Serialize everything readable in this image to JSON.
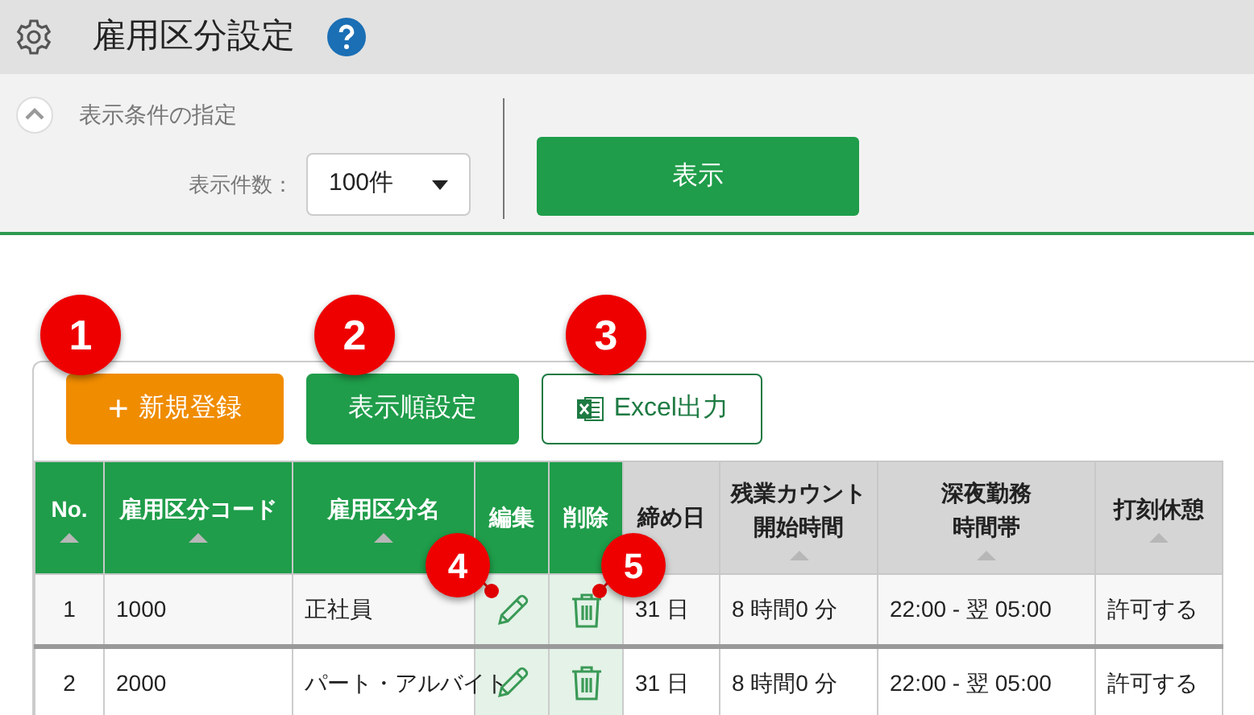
{
  "page_title": "雇用区分設定",
  "conditions": {
    "title": "表示条件の指定",
    "expanded": true,
    "count_label": "表示件数：",
    "count_value": "100件",
    "show_button": "表示"
  },
  "toolbar": [
    {
      "kind": "new",
      "icon": "+",
      "label": "新規登録"
    },
    {
      "kind": "order",
      "label": "表示順設定"
    },
    {
      "kind": "excel",
      "label": "Excel出力"
    }
  ],
  "table": {
    "columns": [
      {
        "label": "No.",
        "kind": "key",
        "sortable": true
      },
      {
        "label": "雇用区分コード",
        "kind": "key",
        "sortable": true
      },
      {
        "label": "雇用区分名",
        "kind": "key",
        "sortable": true
      },
      {
        "label": "編集",
        "kind": "key",
        "sortable": false
      },
      {
        "label": "削除",
        "kind": "key",
        "sortable": false
      },
      {
        "label": "締め日",
        "kind": "plain",
        "sortable": false
      },
      {
        "label": [
          "残業カウント",
          "開始時間"
        ],
        "kind": "plain",
        "sortable": true
      },
      {
        "label": [
          "深夜勤務",
          "時間帯"
        ],
        "kind": "plain",
        "sortable": true
      },
      {
        "label": "打刻休憩",
        "kind": "plain",
        "sortable": true
      }
    ],
    "rows": [
      {
        "no": "1",
        "code": "1000",
        "name": "正社員",
        "closing": "31 日",
        "overtime": "8 時間0 分",
        "night": "22:00 - 翌 05:00",
        "break": "許可する"
      },
      {
        "no": "2",
        "code": "2000",
        "name": "パート・アルバイト",
        "closing": "31 日",
        "overtime": "8 時間0 分",
        "night": "22:00 - 翌 05:00",
        "break": "許可する"
      }
    ]
  },
  "callouts": [
    {
      "label": "1"
    },
    {
      "label": "2"
    },
    {
      "label": "3"
    },
    {
      "label": "4"
    },
    {
      "label": "5"
    }
  ]
}
